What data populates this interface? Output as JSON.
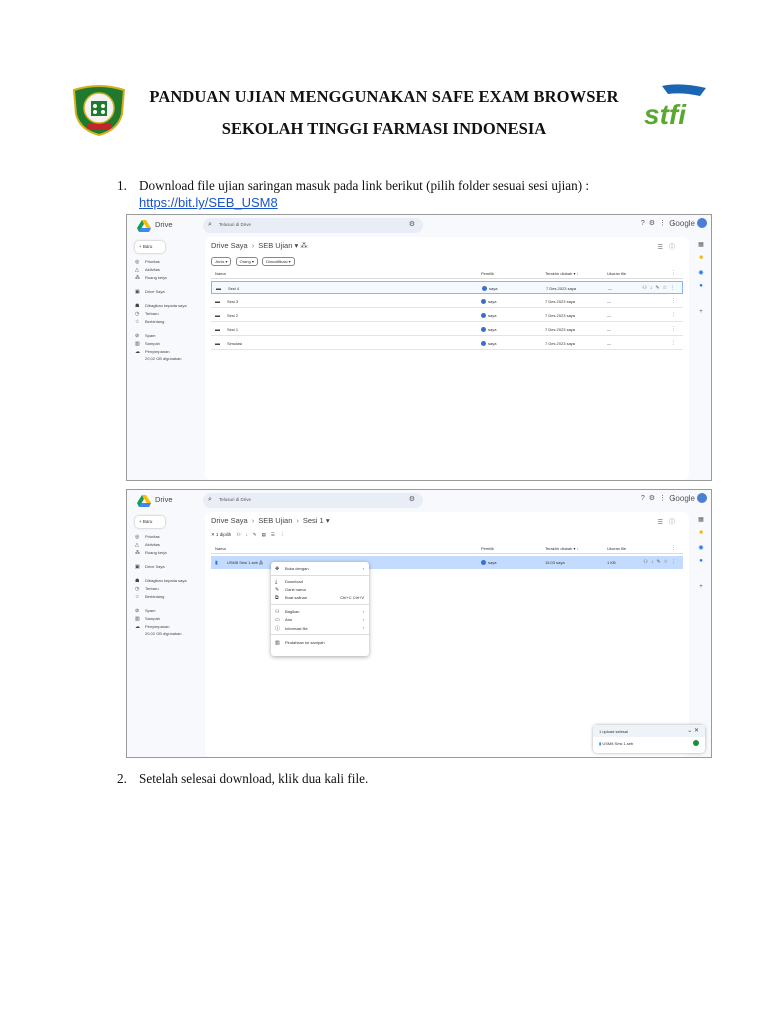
{
  "header": {
    "title_line1": "PANDUAN UJIAN MENGGUNAKAN SAFE EXAM BROWSER",
    "title_line2": "SEKOLAH TINGGI FARMASI INDONESIA",
    "logo_left_text": "SEKOLAH TINGGI FARMASI INDONESIA",
    "logo_right_text": "stfi"
  },
  "steps": [
    {
      "num": "1.",
      "text": "Download file ujian saringan masuk pada link berikut (pilih folder sesuai sesi ujian) :",
      "link": "https://bit.ly/SEB_USM8"
    },
    {
      "num": "2.",
      "text": "Setelah selesai download, klik dua kali file."
    }
  ],
  "drive": {
    "app_name": "Drive",
    "search_placeholder": "Telusuri di Drive",
    "google_word": "Google",
    "new_button": "Baru",
    "nav": [
      "Prioritas",
      "Aktivitas",
      "Ruang kerja",
      "Drive Saya",
      "Dibagikan kepada saya",
      "Terbaru",
      "Berbintang",
      "Spam",
      "Sampah",
      "Penyimpanan"
    ],
    "storage_text": "20,02 GB digunakan",
    "columns": [
      "Nama",
      "Pemilik",
      "Terakhir diubah",
      "Ukuran file"
    ]
  },
  "shot1": {
    "crumb": [
      "Drive Saya",
      "SEB Ujian"
    ],
    "filters": [
      "Jenis",
      "Orang",
      "Dimodifikasi"
    ],
    "rows": [
      {
        "name": "Sesi 4",
        "owner": "saya",
        "date": "7 Des 2023 saya",
        "size": "—"
      },
      {
        "name": "Sesi 3",
        "owner": "saya",
        "date": "7 Des 2023 saya",
        "size": "—"
      },
      {
        "name": "Sesi 2",
        "owner": "saya",
        "date": "7 Des 2023 saya",
        "size": "—"
      },
      {
        "name": "Sesi 1",
        "owner": "saya",
        "date": "7 Des 2023 saya",
        "size": "—"
      },
      {
        "name": "Simulasi",
        "owner": "saya",
        "date": "7 Des 2023 saya",
        "size": "—"
      }
    ]
  },
  "shot2": {
    "crumb": [
      "Drive Saya",
      "SEB Ujian",
      "Sesi 1"
    ],
    "selection": "1 dipilih",
    "row": {
      "name": "USM8 Sesi 1.seb",
      "owner": "saya",
      "date": "15.03 saya",
      "size": "1 KB"
    },
    "menu": [
      {
        "label": "Buka dengan",
        "shortcut": "›"
      },
      {
        "label": "Download",
        "shortcut": ""
      },
      {
        "label": "Ganti nama",
        "shortcut": ""
      },
      {
        "label": "Buat salinan",
        "shortcut": "Ctrl+C Ctrl+V"
      },
      {
        "label": "Bagikan",
        "shortcut": "›"
      },
      {
        "label": "Atur",
        "shortcut": "›"
      },
      {
        "label": "Informasi file",
        "shortcut": "›"
      },
      {
        "label": "Pindahkan ke sampah",
        "shortcut": ""
      }
    ],
    "upload_title": "1 upload selesai",
    "upload_file": "USM8 Sesi 1.seb"
  }
}
